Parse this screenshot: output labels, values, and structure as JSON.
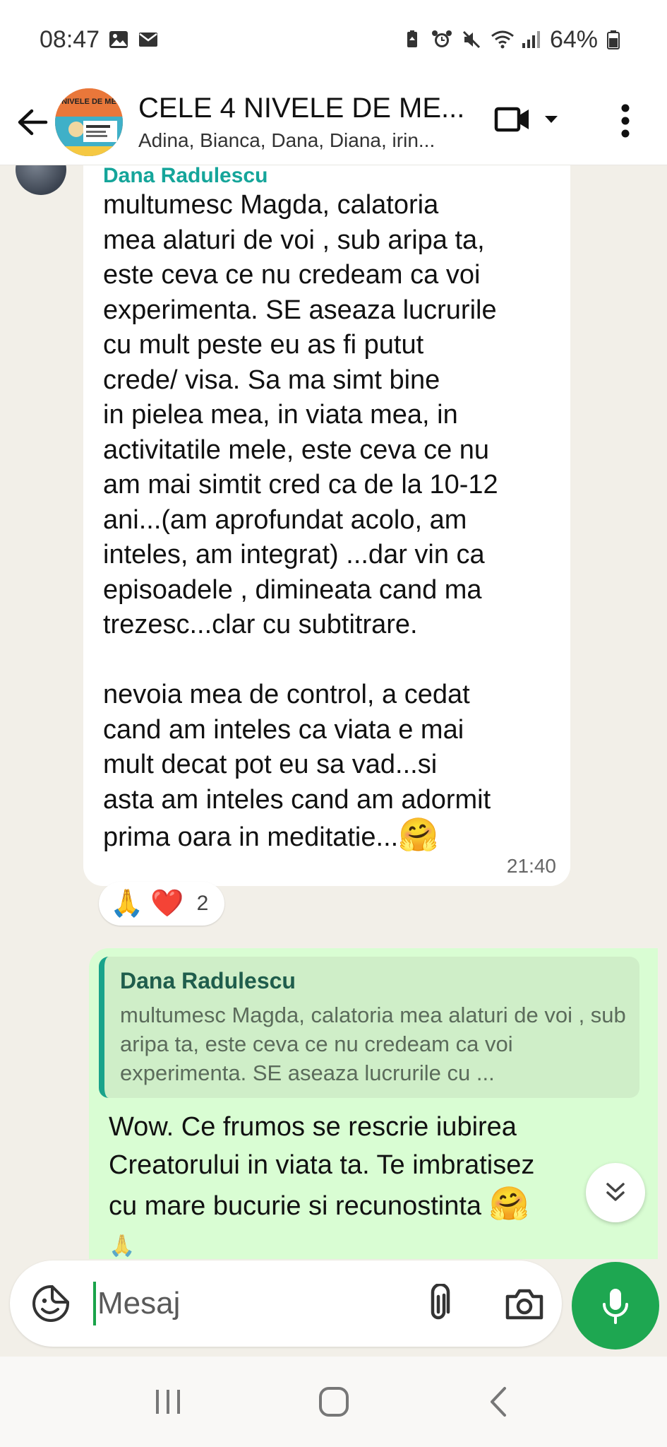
{
  "status_bar": {
    "time": "08:47",
    "battery": "64%",
    "left_icons": [
      "gallery-icon",
      "mail-icon"
    ],
    "right_icons": [
      "battery-saver-icon",
      "alarm-icon",
      "mute-icon",
      "wifi-icon",
      "signal-icon",
      "battery-icon"
    ]
  },
  "header": {
    "title": "CELE 4 NIVELE DE ME...",
    "subtitle": "Adina, Bianca, Dana, Diana, irin...",
    "avatar_text": "NIVELE DE ME"
  },
  "messages": {
    "incoming": {
      "sender": "Dana Radulescu",
      "text": "multumesc Magda, calatoria\nmea alaturi de voi , sub aripa ta,\neste ceva ce nu credeam ca voi\nexperimenta. SE aseaza lucrurile\ncu mult peste eu as fi putut\ncrede/ visa. Sa ma simt bine\nin pielea mea, in viata mea, in\nactivitatile mele, este ceva ce nu\nam mai simtit cred ca de la 10-12\nani...(am aprofundat acolo, am\ninteles, am integrat) ...dar vin ca\nepisoadele , dimineata cand ma\ntrezesc...clar cu subtitrare.\n\nnevoia mea de control, a cedat\ncand am inteles ca viata e mai\nmult decat pot eu sa vad...si\nasta am inteles cand am adormit\nprima oara in meditatie...",
      "emoji": "🤗",
      "time": "21:40",
      "reactions": {
        "emojis": [
          "🙏",
          "❤️"
        ],
        "count": "2"
      }
    },
    "outgoing": {
      "reply_author": "Dana Radulescu",
      "reply_text": "multumesc Magda, calatoria mea alaturi de voi , sub aripa ta, este ceva ce nu credeam ca voi experimenta. SE aseaza lucrurile cu ...",
      "text": "Wow. Ce frumos se rescrie iubirea\nCreatorului in viata ta. Te imbratisez\ncu mare bucurie si recunostinta ",
      "emoji": "🤗",
      "trailing_emoji": "🙏"
    }
  },
  "composer": {
    "placeholder": "Mesaj"
  },
  "colors": {
    "accent_green": "#1ea751",
    "sender_name": "#15a59a",
    "outgoing_bubble": "#d9fdd3",
    "chat_background": "#f2efe8"
  }
}
